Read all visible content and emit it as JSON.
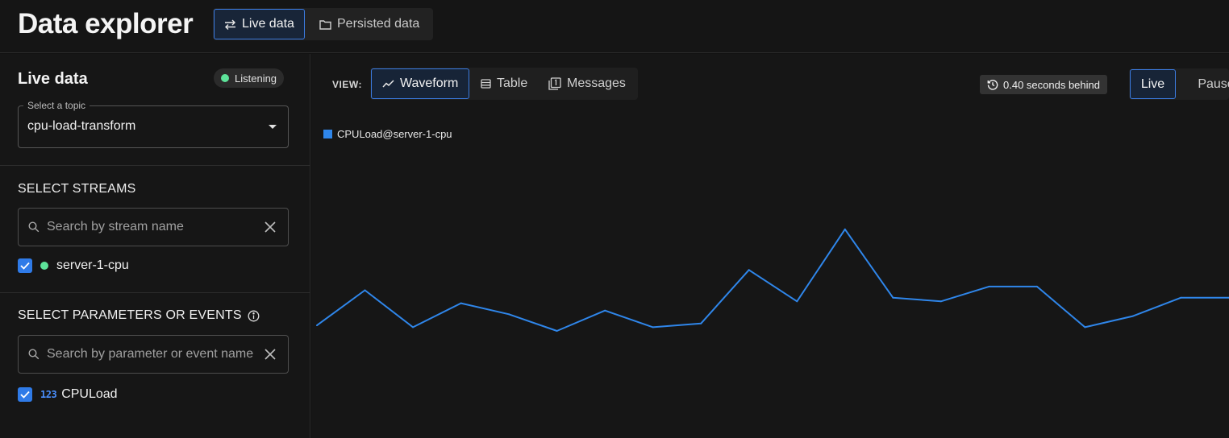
{
  "app": {
    "title": "Data explorer",
    "modes": [
      {
        "label": "Live data",
        "icon": "swap-arrows-icon",
        "active": true
      },
      {
        "label": "Persisted data",
        "icon": "folder-icon",
        "active": false
      }
    ]
  },
  "sidebar": {
    "title": "Live data",
    "status": {
      "label": "Listening",
      "color": "#5de39a"
    },
    "topic": {
      "legend": "Select a topic",
      "value": "cpu-load-transform"
    },
    "streams": {
      "title": "SELECT STREAMS",
      "search_placeholder": "Search by stream name",
      "items": [
        {
          "label": "server-1-cpu",
          "checked": true,
          "dot_color": "#5de39a"
        }
      ]
    },
    "params": {
      "title": "SELECT PARAMETERS OR EVENTS",
      "search_placeholder": "Search by parameter or event name",
      "items": [
        {
          "type_badge": "123",
          "label": "CPULoad",
          "checked": true
        }
      ]
    }
  },
  "main": {
    "view_label": "VIEW:",
    "views": [
      {
        "label": "Waveform",
        "icon": "waveform-icon",
        "active": true
      },
      {
        "label": "Table",
        "icon": "table-icon",
        "active": false
      },
      {
        "label": "Messages",
        "icon": "messages-icon",
        "active": false
      }
    ],
    "behind": "0.40 seconds behind",
    "playback": [
      {
        "label": "Live",
        "active": true
      },
      {
        "label": "Pause",
        "active": false
      }
    ]
  },
  "accent_color": "#3b7be0",
  "chart_data": {
    "type": "line",
    "series": [
      {
        "name": "CPULoad@server-1-cpu",
        "color": "#2f86ea",
        "values": [
          61,
          80,
          60,
          73,
          67,
          58,
          69,
          60,
          62,
          91,
          74,
          113,
          76,
          74,
          82,
          82,
          60,
          66,
          76,
          76
        ]
      }
    ],
    "ylim": [
      0,
      160
    ],
    "grid": false,
    "legend_position": "top-left"
  }
}
